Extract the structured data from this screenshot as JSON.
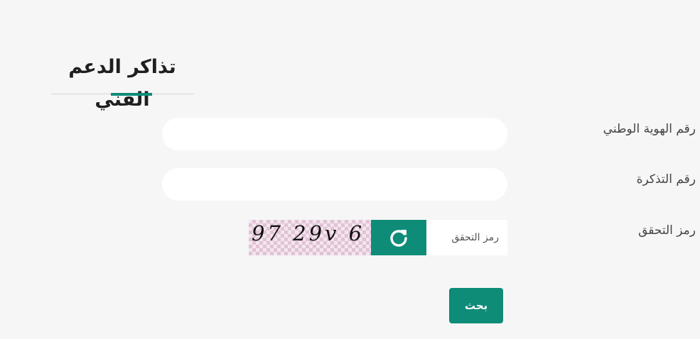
{
  "page": {
    "title": "تذاكر الدعم الفني"
  },
  "form": {
    "national_id": {
      "label": "رقم الهوية الوطني",
      "value": "",
      "placeholder": ""
    },
    "ticket_number": {
      "label": "رقم التذكرة",
      "value": "",
      "placeholder": ""
    },
    "captcha": {
      "label": "رمز التحقق",
      "image_text": "97 29v 6",
      "refresh_icon": "refresh-icon",
      "placeholder": "رمز التحقق",
      "value": ""
    },
    "submit_label": "بحث"
  },
  "colors": {
    "accent": "#0e8c78",
    "background": "#f6f6f6",
    "input_background": "#ffffff",
    "title_text": "#1f1f1f",
    "label_text": "#444444"
  }
}
